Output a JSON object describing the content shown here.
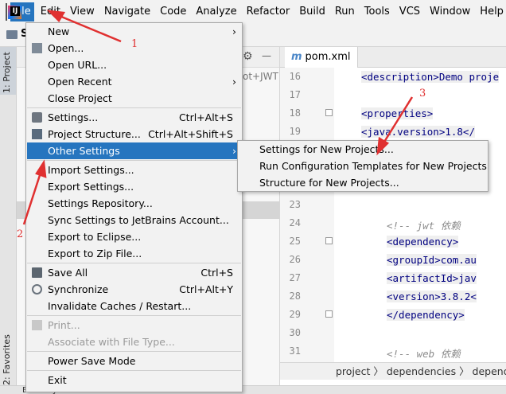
{
  "menubar": {
    "logo_text": "IJ",
    "items": [
      "File",
      "Edit",
      "View",
      "Navigate",
      "Code",
      "Analyze",
      "Refactor",
      "Build",
      "Run",
      "Tools",
      "VCS",
      "Window",
      "Help"
    ],
    "overflow": "S"
  },
  "toolbar": {
    "project_initial": "S"
  },
  "left_strip": {
    "project_label": "1: Project",
    "favorites_label": "2: Favorites"
  },
  "project_panel": {
    "snippet": "ot+JWT"
  },
  "editor": {
    "tab_icon": "m",
    "tab_label": "pom.xml",
    "lines": [
      {
        "n": "16",
        "text": "<description>Demo proje"
      },
      {
        "n": "17",
        "text": ""
      },
      {
        "n": "18",
        "text": "<properties>"
      },
      {
        "n": "19",
        "text": "    <java.version>1.8</"
      },
      {
        "n": "23",
        "text": ""
      },
      {
        "n": "24",
        "text": "<!--   jwt 依赖"
      },
      {
        "n": "25",
        "text": "<dependency>"
      },
      {
        "n": "26",
        "text": "    <groupId>com.au"
      },
      {
        "n": "27",
        "text": "    <artifactId>jav"
      },
      {
        "n": "28",
        "text": "    <version>3.8.2<"
      },
      {
        "n": "29",
        "text": "</dependency>"
      },
      {
        "n": "30",
        "text": ""
      },
      {
        "n": "31",
        "text": "<!--    web 依赖"
      }
    ],
    "breadcrumb": "project 〉 dependencies 〉 depend"
  },
  "status": {
    "text": "Build:   Sync"
  },
  "file_menu": {
    "items": [
      {
        "label": "New",
        "arrow": "›"
      },
      {
        "label": "Open..."
      },
      {
        "label": "Open URL..."
      },
      {
        "label": "Open Recent",
        "arrow": "›"
      },
      {
        "label": "Close Project"
      },
      {
        "label": "Settings...",
        "shortcut": "Ctrl+Alt+S"
      },
      {
        "label": "Project Structure...",
        "shortcut": "Ctrl+Alt+Shift+S"
      },
      {
        "label": "Other Settings",
        "arrow": "›"
      },
      {
        "label": "Import Settings..."
      },
      {
        "label": "Export Settings..."
      },
      {
        "label": "Settings Repository..."
      },
      {
        "label": "Sync Settings to JetBrains Account..."
      },
      {
        "label": "Export to Eclipse..."
      },
      {
        "label": "Export to Zip File..."
      },
      {
        "label": "Save All",
        "shortcut": "Ctrl+S"
      },
      {
        "label": "Synchronize",
        "shortcut": "Ctrl+Alt+Y"
      },
      {
        "label": "Invalidate Caches / Restart..."
      },
      {
        "label": "Print..."
      },
      {
        "label": "Associate with File Type..."
      },
      {
        "label": "Power Save Mode"
      },
      {
        "label": "Exit"
      }
    ]
  },
  "other_settings_submenu": {
    "items": [
      "Settings for New Projects...",
      "Run Configuration Templates for New Projects",
      "Structure for New Projects..."
    ]
  },
  "annotations": {
    "a1": "1",
    "a2": "2",
    "a3": "3"
  },
  "colors": {
    "highlight": "#2675bf",
    "annotation": "#e03030"
  }
}
